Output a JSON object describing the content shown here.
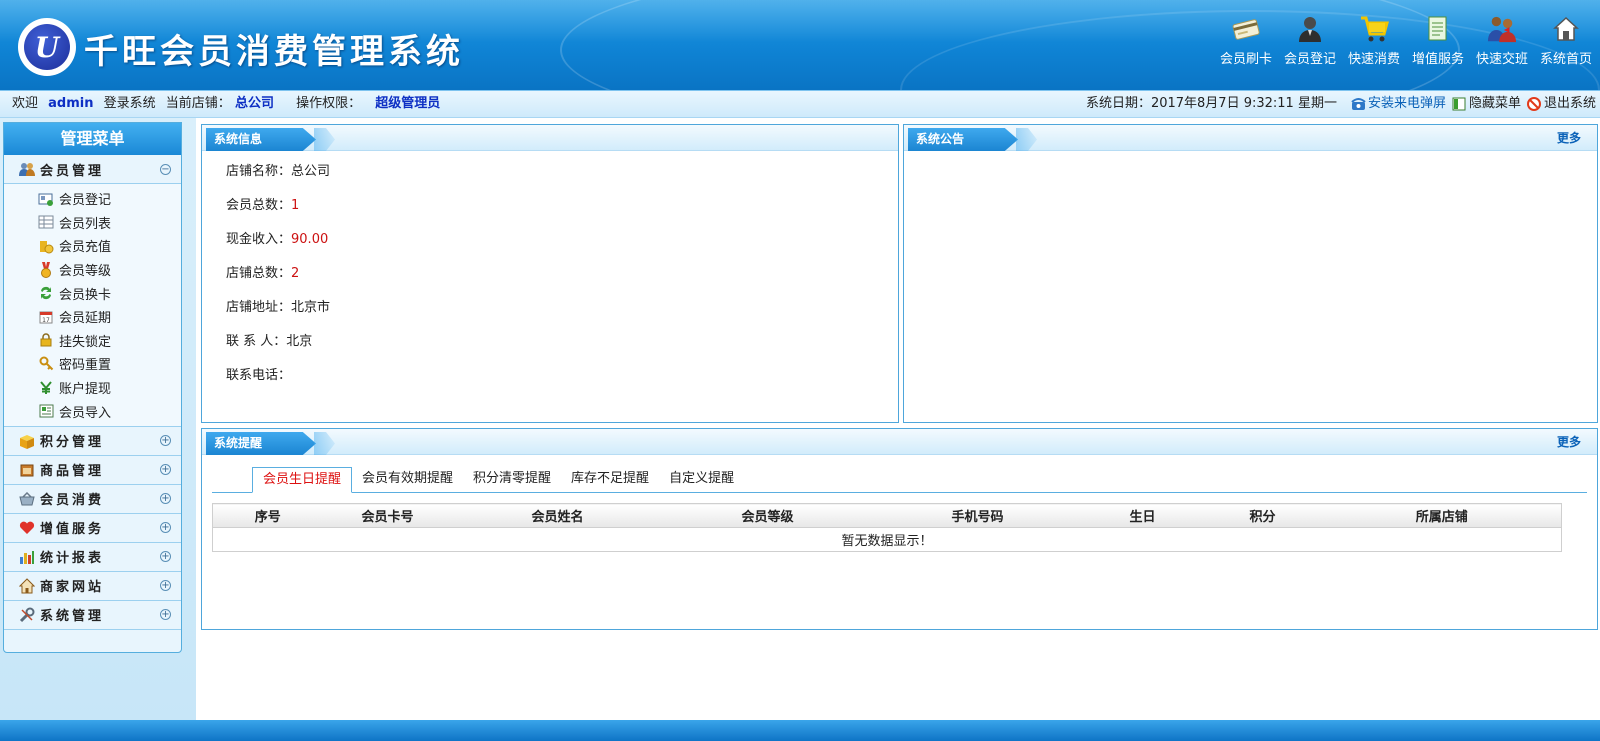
{
  "header": {
    "title": "千旺会员消费管理系统",
    "logo_letter": "U",
    "tools": [
      {
        "label": "会员刷卡",
        "icon": "card-icon"
      },
      {
        "label": "会员登记",
        "icon": "user-icon"
      },
      {
        "label": "快速消费",
        "icon": "cart-icon"
      },
      {
        "label": "增值服务",
        "icon": "document-icon"
      },
      {
        "label": "快速交班",
        "icon": "handover-icon"
      },
      {
        "label": "系统首页",
        "icon": "home-icon"
      }
    ]
  },
  "infobar": {
    "welcome": "欢迎",
    "username": "admin",
    "login_text": "登录系统",
    "store_label": "当前店铺：",
    "store_value": "总公司",
    "perm_label": "操作权限：",
    "perm_value": "超级管理员",
    "date_text": "系统日期：2017年8月7日 9:32:11 星期一",
    "install_popup": "安装来电弹屏",
    "hide_menu": "隐藏菜单",
    "logout": "退出系统"
  },
  "sidebar": {
    "title": "管理菜单",
    "groups": [
      {
        "label": "会员管理",
        "toggle": "−",
        "items": [
          {
            "label": "会员登记"
          },
          {
            "label": "会员列表"
          },
          {
            "label": "会员充值"
          },
          {
            "label": "会员等级"
          },
          {
            "label": "会员换卡"
          },
          {
            "label": "会员延期"
          },
          {
            "label": "挂失锁定"
          },
          {
            "label": "密码重置"
          },
          {
            "label": "账户提现"
          },
          {
            "label": "会员导入"
          }
        ]
      },
      {
        "label": "积分管理",
        "toggle": "+"
      },
      {
        "label": "商品管理",
        "toggle": "+"
      },
      {
        "label": "会员消费",
        "toggle": "+"
      },
      {
        "label": "增值服务",
        "toggle": "+"
      },
      {
        "label": "统计报表",
        "toggle": "+"
      },
      {
        "label": "商家网站",
        "toggle": "+"
      },
      {
        "label": "系统管理",
        "toggle": "+"
      }
    ]
  },
  "sysinfo": {
    "title": "系统信息",
    "rows": [
      {
        "label": "店铺名称：",
        "value": "总公司",
        "red": false
      },
      {
        "label": "会员总数：",
        "value": "1",
        "red": true
      },
      {
        "label": "现金收入：",
        "value": "90.00",
        "red": true
      },
      {
        "label": "店铺总数：",
        "value": "2",
        "red": true
      },
      {
        "label": "店铺地址：",
        "value": "北京市",
        "red": false
      },
      {
        "label": "联 系 人：",
        "value": "北京",
        "red": false
      },
      {
        "label": "联系电话：",
        "value": "",
        "red": false
      }
    ]
  },
  "notice": {
    "title": "系统公告",
    "more": "更多"
  },
  "reminder": {
    "title": "系统提醒",
    "more": "更多",
    "tabs": [
      "会员生日提醒",
      "会员有效期提醒",
      "积分清零提醒",
      "库存不足提醒",
      "自定义提醒"
    ],
    "active_tab": 0,
    "columns": [
      "序号",
      "会员卡号",
      "会员姓名",
      "会员等级",
      "手机号码",
      "生日",
      "积分",
      "所属店铺"
    ],
    "empty_text": "暂无数据显示！"
  },
  "colors": {
    "header_blue": "#0f83d4",
    "red_value": "#cc1111",
    "store_blue": "#0d2fc4"
  }
}
